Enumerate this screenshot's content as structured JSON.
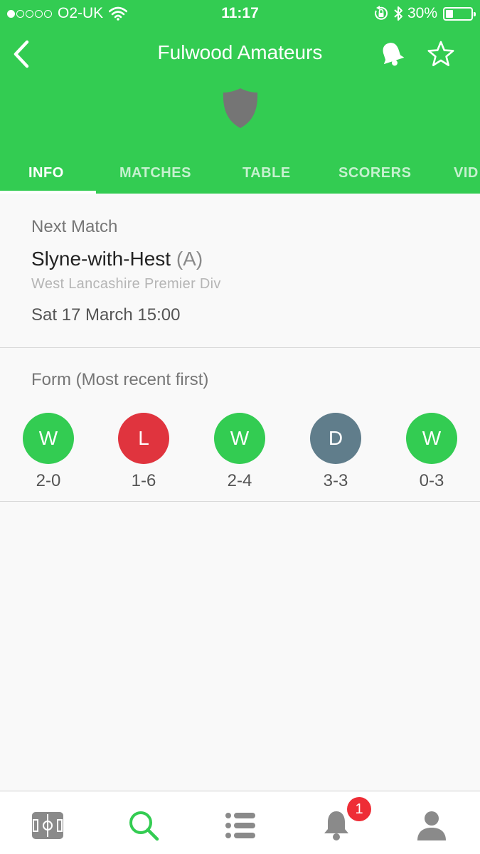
{
  "status_bar": {
    "carrier": "O2-UK",
    "time": "11:17",
    "battery": "30%",
    "battery_level": 0.3
  },
  "header": {
    "title": "Fulwood Amateurs",
    "back_icon": "chevron-left-icon",
    "bell_icon": "bell-icon",
    "star_icon": "star-outline-icon",
    "crest_icon": "shield-icon",
    "bg_color": "#33cc52"
  },
  "tabs": [
    {
      "label": "INFO",
      "active": true
    },
    {
      "label": "MATCHES",
      "active": false
    },
    {
      "label": "TABLE",
      "active": false
    },
    {
      "label": "SCORERS",
      "active": false
    },
    {
      "label": "VID",
      "active": false
    }
  ],
  "next_match": {
    "section_label": "Next Match",
    "opponent": "Slyne-with-Hest",
    "venue": "(A)",
    "league": "West Lancashire Premier Div",
    "kickoff": "Sat 17 March 15:00"
  },
  "form": {
    "section_label": "Form (Most recent first)",
    "results": [
      {
        "result": "W",
        "score": "2-0",
        "color": "#33cc52"
      },
      {
        "result": "L",
        "score": "1-6",
        "color": "#e0343e"
      },
      {
        "result": "W",
        "score": "2-4",
        "color": "#33cc52"
      },
      {
        "result": "D",
        "score": "3-3",
        "color": "#607d8b"
      },
      {
        "result": "W",
        "score": "0-3",
        "color": "#33cc52"
      }
    ]
  },
  "tab_bar": {
    "items": [
      {
        "icon": "pitch-icon",
        "active": false
      },
      {
        "icon": "search-icon",
        "active": true
      },
      {
        "icon": "list-icon",
        "active": false
      },
      {
        "icon": "bell-icon",
        "active": false
      },
      {
        "icon": "user-icon",
        "active": false
      }
    ],
    "notification_badge": "1",
    "active_color": "#33cc52",
    "inactive_color": "#8a8a8a"
  }
}
